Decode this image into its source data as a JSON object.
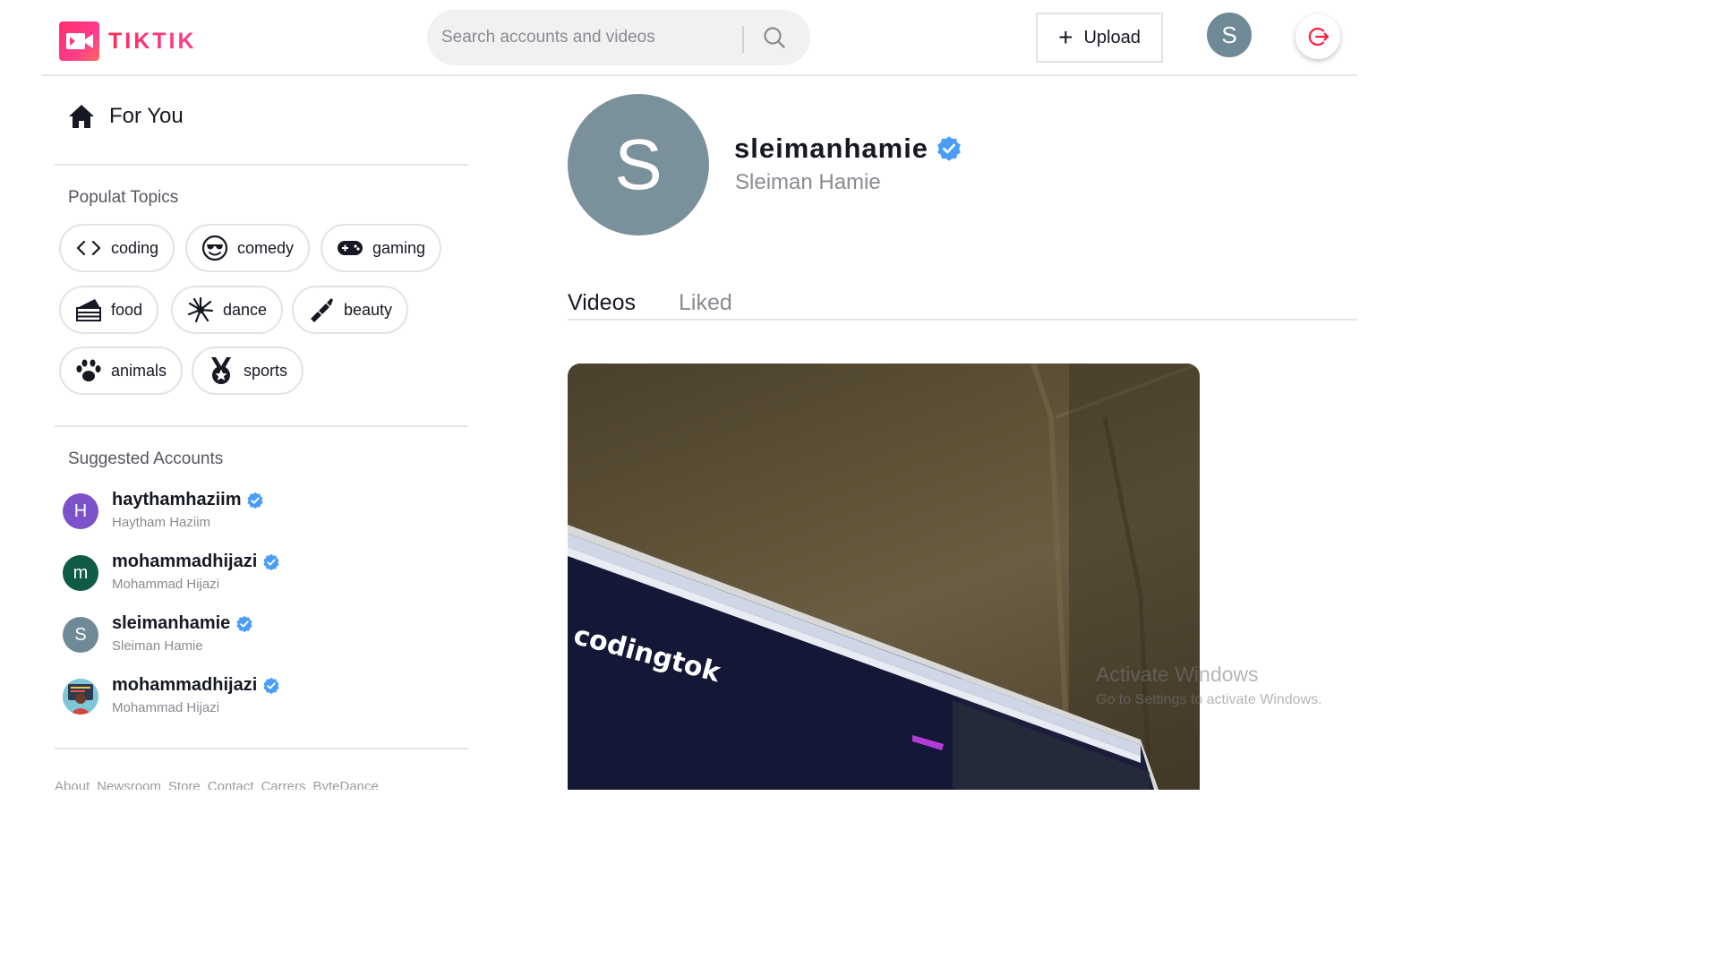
{
  "header": {
    "logo_text": "TIKTIK",
    "search_placeholder": "Search accounts and videos",
    "upload_label": "Upload",
    "avatar_initial": "S"
  },
  "sidebar": {
    "for_you_label": "For You",
    "topics_title": "Populat Topics",
    "topics": [
      {
        "label": "coding",
        "icon": "code-icon"
      },
      {
        "label": "comedy",
        "icon": "cool-face-icon"
      },
      {
        "label": "gaming",
        "icon": "gamepad-icon"
      },
      {
        "label": "food",
        "icon": "cake-icon"
      },
      {
        "label": "dance",
        "icon": "dance-burst-icon"
      },
      {
        "label": "beauty",
        "icon": "lipstick-icon"
      },
      {
        "label": "animals",
        "icon": "paw-icon"
      },
      {
        "label": "sports",
        "icon": "medal-icon"
      }
    ],
    "suggested_title": "Suggested Accounts",
    "accounts": [
      {
        "username": "haythamhaziim",
        "name": "Haytham Haziim",
        "initial": "H",
        "color": "#7b52c9"
      },
      {
        "username": "mohammadhijazi",
        "name": "Mohammad Hijazi",
        "initial": "m",
        "color": "#0f5b45"
      },
      {
        "username": "sleimanhamie",
        "name": "Sleiman Hamie",
        "initial": "S",
        "color": "#6f8a96"
      },
      {
        "username": "mohammadhijazi",
        "name": "Mohammad Hijazi",
        "initial": "",
        "color": "#7fc6d8"
      }
    ],
    "footer_links": [
      "About",
      "Newsroom",
      "Store",
      "Contact",
      "Carrers",
      "ByteDance"
    ]
  },
  "profile": {
    "initial": "S",
    "username": "sleimanhamie",
    "full_name": "Sleiman Hamie"
  },
  "tabs": {
    "videos": "Videos",
    "liked": "Liked"
  },
  "video": {
    "screen_text": "codingtok"
  },
  "watermark": {
    "line1": "Activate Windows",
    "line2": "Go to Settings to activate Windows."
  },
  "colors": {
    "brand": "#ff2c55",
    "verified": "#4a9df8",
    "border": "#e3e3e4"
  }
}
